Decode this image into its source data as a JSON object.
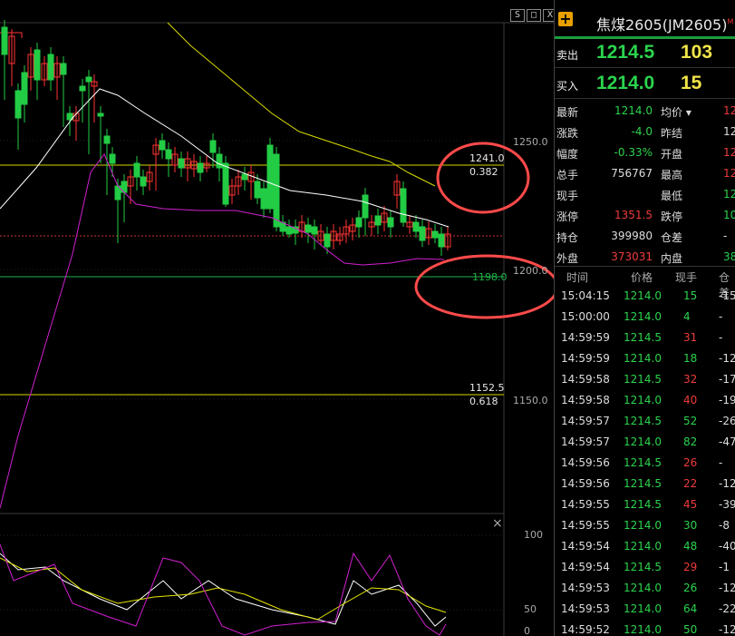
{
  "toolbar": {
    "btn1": "S",
    "btn2": "□",
    "btn3": "X"
  },
  "header": {
    "title": "焦煤2605(JM2605)",
    "badge": "M"
  },
  "quote": {
    "ask_label": "卖出",
    "ask_price": "1214.5",
    "ask_vol": "103",
    "bid_label": "买入",
    "bid_price": "1214.0",
    "bid_vol": "15"
  },
  "stats": [
    {
      "k1": "最新",
      "v1": "1214.0",
      "c1": "g",
      "k2": "均价 ▾",
      "v2": "12",
      "c2": "r"
    },
    {
      "k1": "涨跌",
      "v1": "-4.0",
      "c1": "g",
      "k2": "昨结",
      "v2": "12",
      "c2": "w"
    },
    {
      "k1": "幅度",
      "v1": "-0.33%",
      "c1": "g",
      "k2": "开盘",
      "v2": "12",
      "c2": "r"
    },
    {
      "k1": "总手",
      "v1": "756767",
      "c1": "w",
      "k2": "最高",
      "v2": "12",
      "c2": "r"
    },
    {
      "k1": "现手",
      "v1": "",
      "c1": "w",
      "k2": "最低",
      "v2": "12",
      "c2": "g"
    },
    {
      "k1": "涨停",
      "v1": "1351.5",
      "c1": "r",
      "k2": "跌停",
      "v2": "10",
      "c2": "g"
    },
    {
      "k1": "持仓",
      "v1": "399980",
      "c1": "w",
      "k2": "仓差",
      "v2": "-",
      "c2": "w"
    },
    {
      "k1": "外盘",
      "v1": "373031",
      "c1": "r",
      "k2": "内盘",
      "v2": "38",
      "c2": "g"
    }
  ],
  "tick_header": {
    "time": "时间",
    "price": "价格",
    "vol": "现手",
    "oi": "仓差"
  },
  "ticks": [
    {
      "time": "15:04:15",
      "price": "1214.0",
      "vol": "15",
      "vc": "g",
      "oi": "-15"
    },
    {
      "time": "15:00:00",
      "price": "1214.0",
      "vol": "4",
      "vc": "g",
      "oi": "-"
    },
    {
      "time": "14:59:59",
      "price": "1214.5",
      "vol": "31",
      "vc": "r",
      "oi": "-"
    },
    {
      "time": "14:59:59",
      "price": "1214.0",
      "vol": "18",
      "vc": "g",
      "oi": "-12"
    },
    {
      "time": "14:59:58",
      "price": "1214.5",
      "vol": "32",
      "vc": "r",
      "oi": "-17"
    },
    {
      "time": "14:59:58",
      "price": "1214.0",
      "vol": "40",
      "vc": "r",
      "oi": "-19"
    },
    {
      "time": "14:59:57",
      "price": "1214.5",
      "vol": "52",
      "vc": "g",
      "oi": "-26"
    },
    {
      "time": "14:59:57",
      "price": "1214.0",
      "vol": "82",
      "vc": "g",
      "oi": "-47"
    },
    {
      "time": "14:59:56",
      "price": "1214.5",
      "vol": "26",
      "vc": "r",
      "oi": "-"
    },
    {
      "time": "14:59:56",
      "price": "1214.5",
      "vol": "22",
      "vc": "r",
      "oi": "-12"
    },
    {
      "time": "14:59:55",
      "price": "1214.5",
      "vol": "45",
      "vc": "r",
      "oi": "-39"
    },
    {
      "time": "14:59:55",
      "price": "1214.0",
      "vol": "30",
      "vc": "g",
      "oi": "-8"
    },
    {
      "time": "14:59:54",
      "price": "1214.0",
      "vol": "48",
      "vc": "g",
      "oi": "-40"
    },
    {
      "time": "14:59:54",
      "price": "1214.5",
      "vol": "29",
      "vc": "r",
      "oi": "-1"
    },
    {
      "time": "14:59:53",
      "price": "1214.0",
      "vol": "26",
      "vc": "g",
      "oi": "-12"
    },
    {
      "time": "14:59:53",
      "price": "1214.0",
      "vol": "64",
      "vc": "g",
      "oi": "-22"
    },
    {
      "time": "14:59:52",
      "price": "1214.0",
      "vol": "50",
      "vc": "g",
      "oi": "-12"
    }
  ],
  "chart": {
    "y_ticks": [
      "1250.0",
      "1200.0",
      "1150.0"
    ],
    "fib": [
      {
        "price": "1241.0",
        "ratio": "0.382"
      },
      {
        "price": "1198.0",
        "ratio": ""
      },
      {
        "price": "1152.5",
        "ratio": "0.618"
      }
    ],
    "kdj_ticks": [
      "100",
      "50",
      "0"
    ],
    "close_icon": "×",
    "colors": {
      "up": "#ff3333",
      "down": "#22cc44",
      "ma": "#ffffff",
      "band_upper": "#d8d800",
      "band_lower": "#d020d0",
      "annot": "#ff4a4a"
    }
  }
}
